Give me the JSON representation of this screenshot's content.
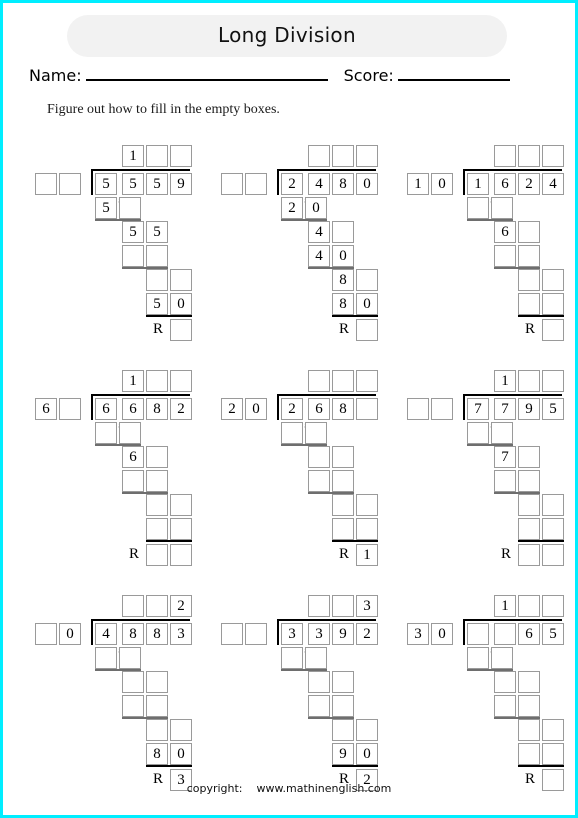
{
  "header": {
    "title": "Long Division",
    "name_label": "Name:",
    "score_label": "Score:"
  },
  "instruction": "Figure out how to fill in the empty boxes.",
  "footer": {
    "copyright_label": "copyright:",
    "site": "www.mathinenglish.com"
  },
  "remainder_label": "R",
  "thousands_separator": ",",
  "colors": {
    "page_border": "#00eeff",
    "title_pill": "#f2f2f2",
    "box_border": "#9a9a9a",
    "bracket": "#000000",
    "underline": "#6e6e6e"
  },
  "problems": [
    {
      "id": 1,
      "divisor": [
        "",
        ""
      ],
      "dividend": [
        "5",
        "5",
        "5",
        "9"
      ],
      "quotient": [
        "1",
        "",
        ""
      ],
      "steps": [
        {
          "indent": 0,
          "digits": [
            "5",
            ""
          ]
        },
        {
          "indent": 1,
          "digits": [
            "5",
            "5"
          ]
        },
        {
          "indent": 1,
          "digits": [
            "",
            ""
          ]
        },
        {
          "indent": 2,
          "digits": [
            "",
            ""
          ]
        },
        {
          "indent": 2,
          "digits": [
            "5",
            "0"
          ]
        }
      ],
      "remainder": [
        ""
      ]
    },
    {
      "id": 2,
      "divisor": [
        "",
        ""
      ],
      "dividend": [
        "2",
        "4",
        "8",
        "0"
      ],
      "quotient": [
        "",
        "",
        ""
      ],
      "steps": [
        {
          "indent": 0,
          "digits": [
            "2",
            "0"
          ]
        },
        {
          "indent": 1,
          "digits": [
            "4",
            ""
          ]
        },
        {
          "indent": 1,
          "digits": [
            "4",
            "0"
          ]
        },
        {
          "indent": 2,
          "digits": [
            "8",
            ""
          ]
        },
        {
          "indent": 2,
          "digits": [
            "8",
            "0"
          ]
        }
      ],
      "remainder": [
        ""
      ]
    },
    {
      "id": 3,
      "divisor": [
        "1",
        "0"
      ],
      "dividend": [
        "1",
        "6",
        "2",
        "4"
      ],
      "quotient": [
        "",
        "",
        ""
      ],
      "steps": [
        {
          "indent": 0,
          "digits": [
            "",
            ""
          ]
        },
        {
          "indent": 1,
          "digits": [
            "6",
            ""
          ]
        },
        {
          "indent": 1,
          "digits": [
            "",
            ""
          ]
        },
        {
          "indent": 2,
          "digits": [
            "",
            ""
          ]
        },
        {
          "indent": 2,
          "digits": [
            "",
            ""
          ]
        }
      ],
      "remainder": [
        ""
      ]
    },
    {
      "id": 4,
      "divisor": [
        "6",
        ""
      ],
      "dividend": [
        "6",
        "6",
        "8",
        "2"
      ],
      "quotient": [
        "1",
        "",
        ""
      ],
      "steps": [
        {
          "indent": 0,
          "digits": [
            "",
            ""
          ]
        },
        {
          "indent": 1,
          "digits": [
            "6",
            ""
          ]
        },
        {
          "indent": 1,
          "digits": [
            "",
            ""
          ]
        },
        {
          "indent": 2,
          "digits": [
            "",
            ""
          ]
        },
        {
          "indent": 2,
          "digits": [
            "",
            ""
          ]
        }
      ],
      "remainder": [
        "",
        ""
      ]
    },
    {
      "id": 5,
      "divisor": [
        "2",
        "0"
      ],
      "dividend": [
        "2",
        "6",
        "8",
        ""
      ],
      "quotient": [
        "",
        "",
        ""
      ],
      "steps": [
        {
          "indent": 0,
          "digits": [
            "",
            ""
          ]
        },
        {
          "indent": 1,
          "digits": [
            "",
            ""
          ]
        },
        {
          "indent": 1,
          "digits": [
            "",
            ""
          ]
        },
        {
          "indent": 2,
          "digits": [
            "",
            ""
          ]
        },
        {
          "indent": 2,
          "digits": [
            "",
            ""
          ]
        }
      ],
      "remainder": [
        "1"
      ]
    },
    {
      "id": 6,
      "divisor": [
        "",
        ""
      ],
      "dividend": [
        "7",
        "7",
        "9",
        "5"
      ],
      "quotient": [
        "1",
        "",
        ""
      ],
      "steps": [
        {
          "indent": 0,
          "digits": [
            "",
            ""
          ]
        },
        {
          "indent": 1,
          "digits": [
            "7",
            ""
          ]
        },
        {
          "indent": 1,
          "digits": [
            "",
            ""
          ]
        },
        {
          "indent": 2,
          "digits": [
            "",
            ""
          ]
        },
        {
          "indent": 2,
          "digits": [
            "",
            ""
          ]
        }
      ],
      "remainder": [
        "",
        ""
      ]
    },
    {
      "id": 7,
      "divisor": [
        "",
        "0"
      ],
      "dividend": [
        "4",
        "8",
        "8",
        "3"
      ],
      "quotient": [
        "",
        "",
        "2"
      ],
      "steps": [
        {
          "indent": 0,
          "digits": [
            "",
            ""
          ]
        },
        {
          "indent": 1,
          "digits": [
            "",
            ""
          ]
        },
        {
          "indent": 1,
          "digits": [
            "",
            ""
          ]
        },
        {
          "indent": 2,
          "digits": [
            "",
            ""
          ]
        },
        {
          "indent": 2,
          "digits": [
            "8",
            "0"
          ]
        }
      ],
      "remainder": [
        "3"
      ]
    },
    {
      "id": 8,
      "divisor": [
        "",
        ""
      ],
      "dividend": [
        "3",
        "3",
        "9",
        "2"
      ],
      "quotient": [
        "",
        "",
        "3"
      ],
      "steps": [
        {
          "indent": 0,
          "digits": [
            "",
            ""
          ]
        },
        {
          "indent": 1,
          "digits": [
            "",
            ""
          ]
        },
        {
          "indent": 1,
          "digits": [
            "",
            ""
          ]
        },
        {
          "indent": 2,
          "digits": [
            "",
            ""
          ]
        },
        {
          "indent": 2,
          "digits": [
            "9",
            "0"
          ]
        }
      ],
      "remainder": [
        "2"
      ]
    },
    {
      "id": 9,
      "divisor": [
        "3",
        "0"
      ],
      "dividend": [
        "",
        "",
        "6",
        "5"
      ],
      "quotient": [
        "1",
        "",
        ""
      ],
      "steps": [
        {
          "indent": 0,
          "digits": [
            "",
            ""
          ]
        },
        {
          "indent": 1,
          "digits": [
            "",
            ""
          ]
        },
        {
          "indent": 1,
          "digits": [
            "",
            ""
          ]
        },
        {
          "indent": 2,
          "digits": [
            "",
            ""
          ]
        },
        {
          "indent": 2,
          "digits": [
            "",
            ""
          ]
        }
      ],
      "remainder": [
        ""
      ]
    }
  ]
}
